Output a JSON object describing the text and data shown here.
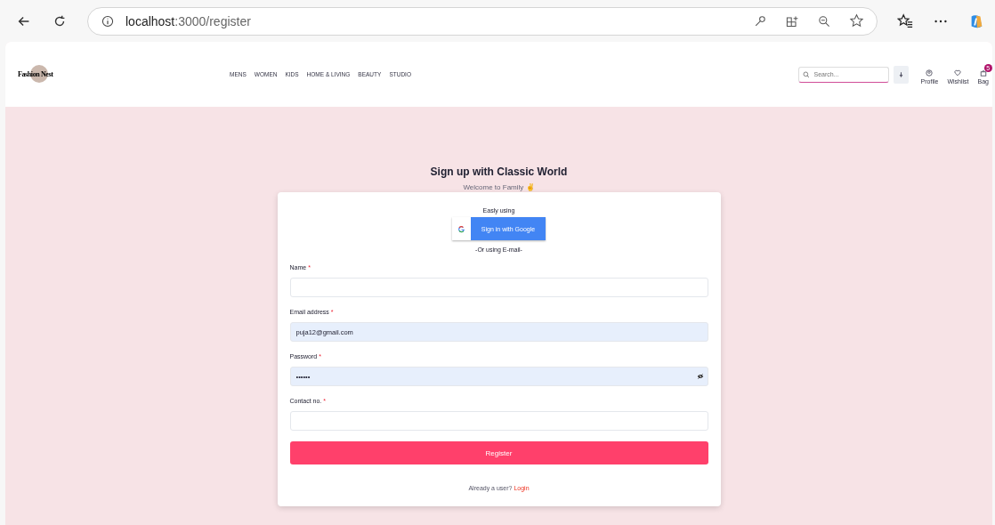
{
  "browser": {
    "url_host": "localhost",
    "url_path": ":3000/register"
  },
  "header": {
    "logo": "Fashion Nest",
    "nav": [
      "MENS",
      "WOMEN",
      "KIDS",
      "HOME & LIVING",
      "BEAUTY",
      "STUDIO"
    ],
    "search": {
      "placeholder": "Search..."
    },
    "actions": [
      {
        "kind": "profile",
        "label": "Profile"
      },
      {
        "kind": "wishlist",
        "label": "Wishlist"
      },
      {
        "kind": "bag",
        "label": "Bag",
        "badge": "5"
      }
    ]
  },
  "form": {
    "title": "Sign up with Classic World",
    "subtitle": "Welcome to Family ✌",
    "easy": "Easly using",
    "google": "Sign in with Google",
    "divider": "-Or using E-mail-",
    "fields": [
      {
        "label": "Name",
        "required": "*",
        "autofilled": false,
        "kind": "text"
      },
      {
        "label": "Email address",
        "required": "*",
        "value": "puja12@gmail.com",
        "autofilled": true,
        "kind": "text"
      },
      {
        "label": "Password",
        "required": "*",
        "value": "••••••",
        "autofilled": true,
        "kind": "password"
      },
      {
        "label": "Contact no.",
        "required": "*",
        "autofilled": false,
        "kind": "text"
      }
    ],
    "submit": "Register",
    "login_prompt": "Already a user?",
    "login_link": "Login"
  }
}
